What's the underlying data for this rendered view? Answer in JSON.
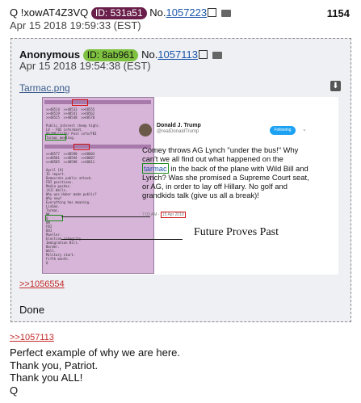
{
  "post": {
    "tripcode": "Q !xowAT4Z3VQ",
    "id_label": "ID: 531a51",
    "no_label": "No.",
    "no_link": "1057223",
    "post_count": "1154",
    "date": "Apr 15 2018 19:59:33 (EST)",
    "message_ref": ">>1057113",
    "message_lines": [
      "Perfect example of why we are here.",
      "Thank you, Patriot.",
      "Thank you ALL!",
      "Q"
    ]
  },
  "quoted": {
    "name": "Anonymous",
    "id_label": "ID: 8ab961",
    "no_label": "No.",
    "no_link": "1057113",
    "date": "Apr 15 2018 19:54:38 (EST)",
    "filename": "Tarmac.png",
    "reply_ref": ">>1056554",
    "text": "Done",
    "image": {
      "tweet_name": "Donald J. Trump",
      "tweet_handle": "@realDonaldTrump",
      "follow_label": "Following",
      "tweet_pre": "Comey throws AG Lynch \"under the bus!\" Why can't we all find out what happened on the ",
      "tweet_highlight": "tarmac",
      "tweet_post": " in the back of the plane with Wild Bill and Lynch? Was she promised a Supreme Court seat, or AG, in order to lay off Hillary. No golf and grandkids talk (give us all a break)!",
      "tweet_time": "7:03 AM - ",
      "tweet_date": "15 Apr 2018",
      "caption": "Future Proves Past"
    }
  },
  "colors": {
    "id_badge_q": "#6a1f4a",
    "id_badge_anon": "#7fc241",
    "link_red": "#c42a2a",
    "link_blue": "#1a55a8"
  },
  "icons": [
    "external-link-icon",
    "folder-icon",
    "download-icon",
    "chevron-down-icon"
  ]
}
